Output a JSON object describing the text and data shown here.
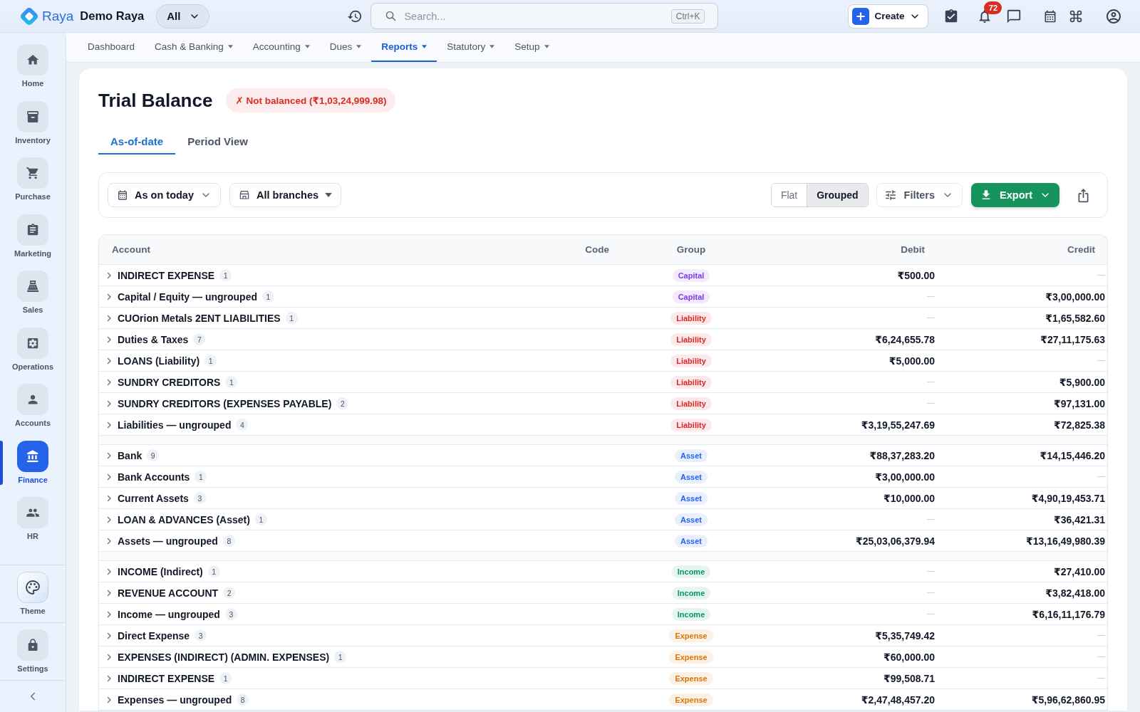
{
  "topbar": {
    "brand": "Raya",
    "workspace": "Demo Raya",
    "scope": "All",
    "search": {
      "placeholder": "Search...",
      "shortcut": "Ctrl+K"
    },
    "create": "Create",
    "notifications": "72"
  },
  "sidebar": {
    "items": [
      {
        "label": "Home",
        "selected": false
      },
      {
        "label": "Inventory",
        "selected": false
      },
      {
        "label": "Purchase",
        "selected": false
      },
      {
        "label": "Marketing",
        "selected": false
      },
      {
        "label": "Sales",
        "selected": false
      },
      {
        "label": "Operations",
        "selected": false
      },
      {
        "label": "Accounts",
        "selected": false
      },
      {
        "label": "Finance",
        "selected": true
      },
      {
        "label": "HR",
        "selected": false
      }
    ],
    "footer_items": [
      {
        "label": "Theme",
        "selected": false
      },
      {
        "label": "Settings",
        "selected": false
      }
    ]
  },
  "nav": {
    "items": [
      {
        "label": "Dashboard",
        "selected": false,
        "menu": false
      },
      {
        "label": "Cash & Banking",
        "selected": false,
        "menu": true
      },
      {
        "label": "Accounting",
        "selected": false,
        "menu": true
      },
      {
        "label": "Dues",
        "selected": false,
        "menu": true
      },
      {
        "label": "Reports",
        "selected": true,
        "menu": true
      },
      {
        "label": "Statutory",
        "selected": false,
        "menu": true
      },
      {
        "label": "Setup",
        "selected": false,
        "menu": true
      }
    ]
  },
  "page": {
    "title": "Trial Balance",
    "status": "✗ Not balanced (₹1,03,24,999.98)",
    "tabs": [
      {
        "label": "As-of-date",
        "selected": true
      },
      {
        "label": "Period View",
        "selected": false
      }
    ]
  },
  "toolbar": {
    "date": "As on today",
    "branch": "All branches",
    "view_modes": [
      {
        "label": "Flat",
        "selected": false
      },
      {
        "label": "Grouped",
        "selected": true
      }
    ],
    "filters": "Filters",
    "export": "Export"
  },
  "table": {
    "columns": [
      "Account",
      "Code",
      "Group",
      "Debit",
      "Credit"
    ],
    "sections": [
      {
        "rows": [
          {
            "account": "INDIRECT EXPENSE",
            "count": "1",
            "expanded": false,
            "group": {
              "label": "Capital",
              "color": "#7c3aed"
            },
            "debit": "₹500.00"
          },
          {
            "account": "Capital / Equity — ungrouped",
            "count": "1",
            "expanded": false,
            "group": {
              "label": "Capital",
              "color": "#7c3aed"
            },
            "credit": "₹3,00,000.00"
          },
          {
            "account": "CUOrion Metals 2ENT LIABILITIES",
            "count": "1",
            "expanded": false,
            "group": {
              "label": "Liability",
              "color": "#dc2626"
            },
            "credit": "₹1,65,582.60"
          },
          {
            "account": "Duties & Taxes",
            "count": "7",
            "expanded": false,
            "group": {
              "label": "Liability",
              "color": "#dc2626"
            },
            "debit": "₹6,24,655.78",
            "credit": "₹27,11,175.63"
          },
          {
            "account": "LOANS (Liability)",
            "count": "1",
            "expanded": false,
            "group": {
              "label": "Liability",
              "color": "#dc2626"
            },
            "debit": "₹5,000.00"
          },
          {
            "account": "SUNDRY CREDITORS",
            "count": "1",
            "expanded": false,
            "group": {
              "label": "Liability",
              "color": "#dc2626"
            },
            "credit": "₹5,900.00"
          },
          {
            "account": "SUNDRY CREDITORS (EXPENSES PAYABLE)",
            "count": "2",
            "expanded": false,
            "group": {
              "label": "Liability",
              "color": "#dc2626"
            },
            "credit": "₹97,131.00"
          },
          {
            "account": "Liabilities — ungrouped",
            "count": "4",
            "expanded": false,
            "group": {
              "label": "Liability",
              "color": "#dc2626"
            },
            "debit": "₹3,19,55,247.69",
            "credit": "₹72,825.38"
          }
        ]
      },
      {
        "rows": [
          {
            "account": "Bank",
            "count": "9",
            "expanded": false,
            "group": {
              "label": "Asset",
              "color": "#2563eb"
            },
            "debit": "₹88,37,283.20",
            "credit": "₹14,15,446.20"
          },
          {
            "account": "Bank Accounts",
            "count": "1",
            "expanded": false,
            "group": {
              "label": "Asset",
              "color": "#2563eb"
            },
            "debit": "₹3,00,000.00"
          },
          {
            "account": "Current Assets",
            "count": "3",
            "expanded": false,
            "group": {
              "label": "Asset",
              "color": "#2563eb"
            },
            "debit": "₹10,000.00",
            "credit": "₹4,90,19,453.71"
          },
          {
            "account": "LOAN & ADVANCES (Asset)",
            "count": "1",
            "expanded": false,
            "group": {
              "label": "Asset",
              "color": "#2563eb"
            },
            "credit": "₹36,421.31"
          },
          {
            "account": "Assets — ungrouped",
            "count": "8",
            "expanded": false,
            "group": {
              "label": "Asset",
              "color": "#2563eb"
            },
            "debit": "₹25,03,06,379.94",
            "credit": "₹13,16,49,980.39"
          }
        ]
      },
      {
        "rows": [
          {
            "account": "INCOME (Indirect)",
            "count": "1",
            "expanded": false,
            "group": {
              "label": "Income",
              "color": "#059669"
            },
            "credit": "₹27,410.00"
          },
          {
            "account": "REVENUE ACCOUNT",
            "count": "2",
            "expanded": false,
            "group": {
              "label": "Income",
              "color": "#059669"
            },
            "credit": "₹3,82,418.00"
          },
          {
            "account": "Income — ungrouped",
            "count": "3",
            "expanded": false,
            "group": {
              "label": "Income",
              "color": "#059669"
            },
            "credit": "₹6,16,11,176.79"
          },
          {
            "account": "Direct Expense",
            "count": "3",
            "expanded": false,
            "group": {
              "label": "Expense",
              "color": "#d97706"
            },
            "debit": "₹5,35,749.42"
          },
          {
            "account": "EXPENSES (INDIRECT) (ADMIN. EXPENSES)",
            "count": "1",
            "expanded": false,
            "group": {
              "label": "Expense",
              "color": "#d97706"
            },
            "debit": "₹60,000.00"
          },
          {
            "account": "INDIRECT EXPENSE",
            "count": "1",
            "expanded": false,
            "group": {
              "label": "Expense",
              "color": "#d97706"
            },
            "debit": "₹99,508.71"
          },
          {
            "account": "Expenses — ungrouped",
            "count": "8",
            "expanded": false,
            "group": {
              "label": "Expense",
              "color": "#d97706"
            },
            "debit": "₹2,47,48,457.20",
            "credit": "₹5,96,62,860.95"
          }
        ]
      }
    ]
  }
}
